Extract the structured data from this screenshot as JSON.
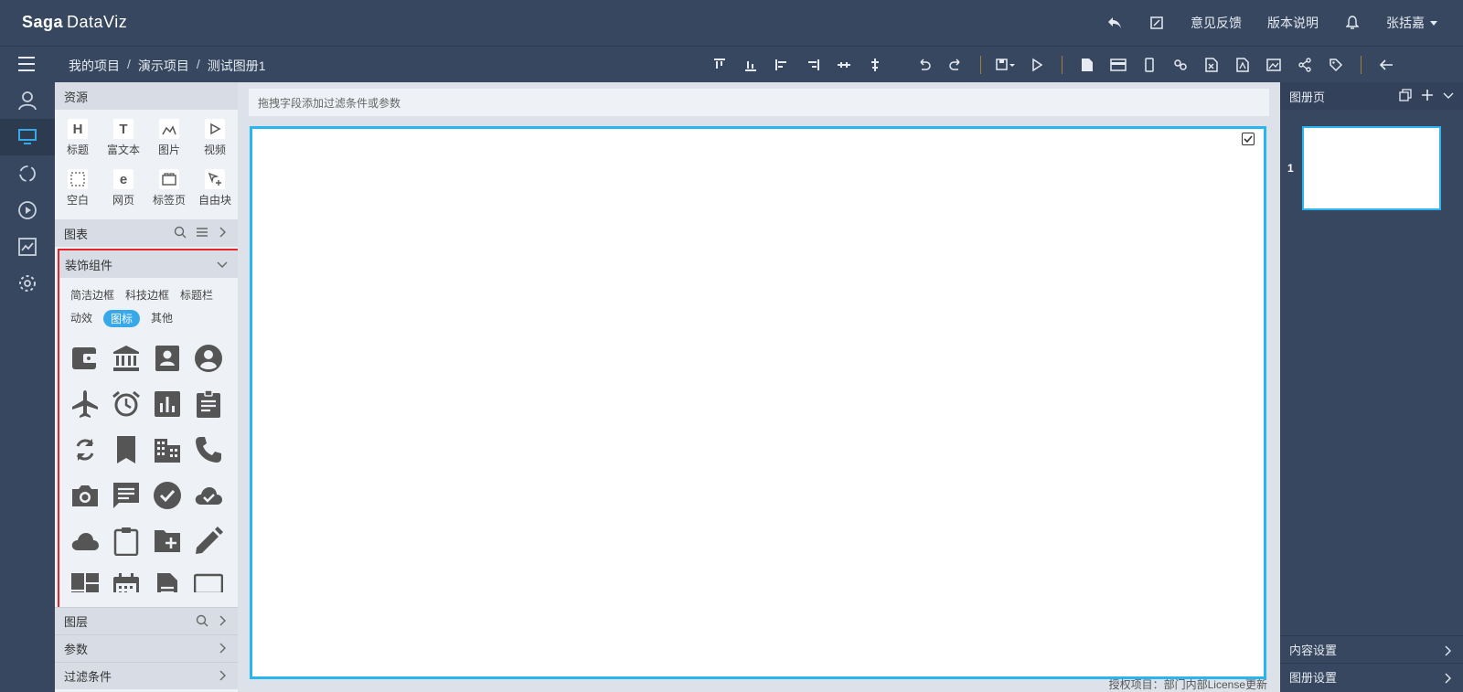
{
  "app": {
    "logo_main": "Saga",
    "logo_sub": "DataViz"
  },
  "header": {
    "feedback": "意见反馈",
    "release_notes": "版本说明",
    "user": "张括嘉"
  },
  "breadcrumb": [
    "我的项目",
    "演示项目",
    "测试图册1"
  ],
  "breadcrumb_sep": "/",
  "resources": {
    "title": "资源",
    "items": [
      {
        "icon": "H",
        "label": "标题"
      },
      {
        "icon": "T",
        "label": "富文本"
      },
      {
        "icon": "image",
        "label": "图片"
      },
      {
        "icon": "video",
        "label": "视频"
      },
      {
        "icon": "blank",
        "label": "空白"
      },
      {
        "icon": "e",
        "label": "网页"
      },
      {
        "icon": "tabs",
        "label": "标签页"
      },
      {
        "icon": "free",
        "label": "自由块"
      }
    ]
  },
  "charts_section": {
    "title": "图表"
  },
  "decoration": {
    "title": "装饰组件",
    "tabs": [
      "简洁边框",
      "科技边框",
      "标题栏",
      "动效",
      "图标",
      "其他"
    ],
    "active_tab": "图标",
    "icons": [
      "wallet-icon",
      "bank-icon",
      "contact-card-icon",
      "account-circle-icon",
      "airplane-icon",
      "alarm-icon",
      "bar-chart-icon",
      "assignment-icon",
      "refresh-icon",
      "bookmark-icon",
      "building-icon",
      "phone-icon",
      "camera-icon",
      "chat-icon",
      "check-circle-icon",
      "cloud-done-icon",
      "cloud-icon",
      "clipboard-icon",
      "folder-add-icon",
      "pencil-icon",
      "dashboard-icon",
      "calendar-icon",
      "document-icon",
      "monitor-icon"
    ]
  },
  "lower_sections": [
    "图层",
    "参数",
    "过滤条件"
  ],
  "workarea": {
    "filter_placeholder": "拖拽字段添加过滤条件或参数",
    "license": "授权项目：部门内部License更新"
  },
  "right_panel": {
    "title": "图册页",
    "page_number": "1",
    "content_settings": "内容设置",
    "album_settings": "图册设置"
  },
  "colors": {
    "topbar": "#37475f",
    "accent": "#29b6f0",
    "highlight_border": "#e8222a",
    "active_tab": "#38a9e8"
  }
}
